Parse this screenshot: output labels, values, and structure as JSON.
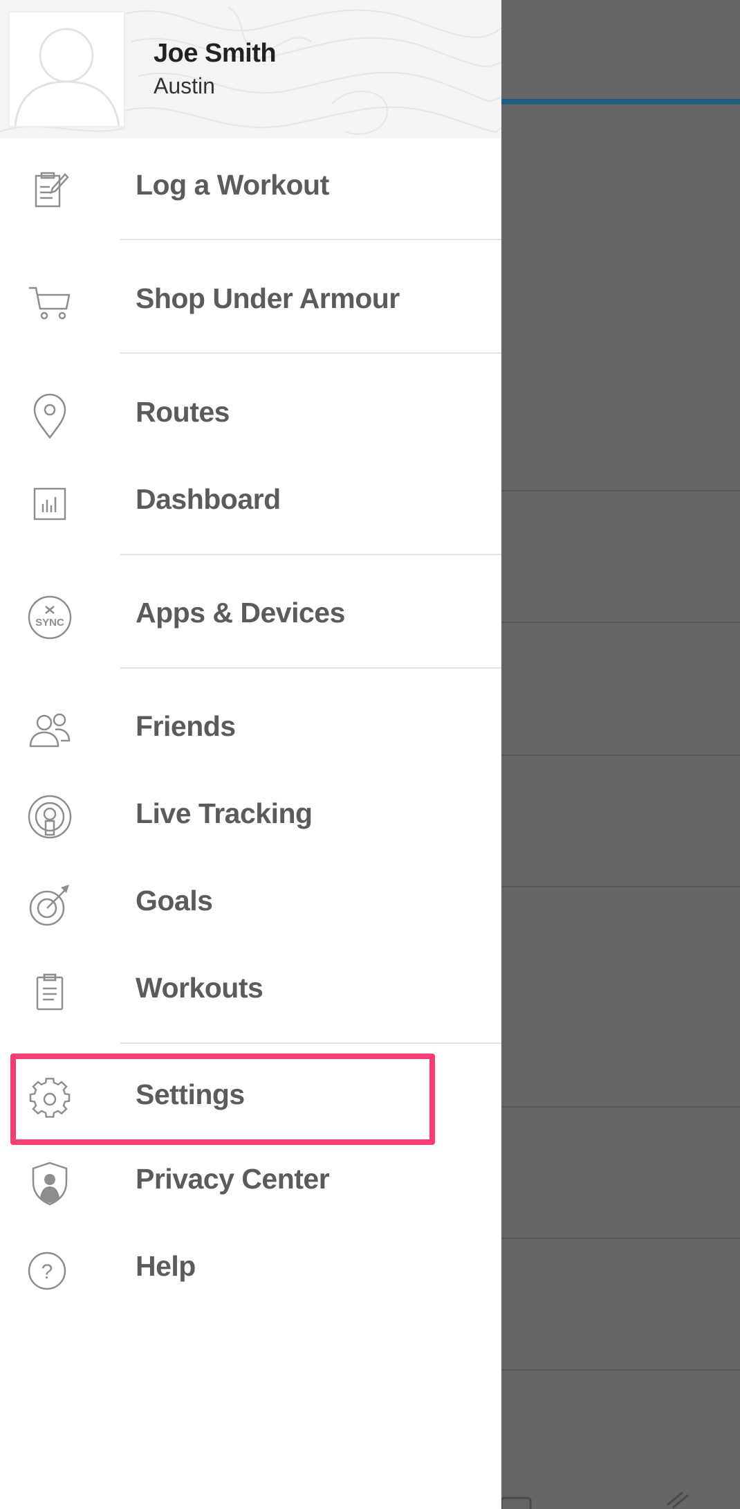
{
  "profile": {
    "name": "Joe Smith",
    "location": "Austin"
  },
  "menu": {
    "items": [
      {
        "label": "Log a Workout",
        "icon": "log-workout-icon"
      },
      {
        "label": "Shop Under Armour",
        "icon": "shopping-cart-icon"
      },
      {
        "label": "Routes",
        "icon": "location-pin-icon"
      },
      {
        "label": "Dashboard",
        "icon": "bar-chart-icon"
      },
      {
        "label": "Apps & Devices",
        "icon": "sync-icon",
        "icon_text": "SYNC"
      },
      {
        "label": "Friends",
        "icon": "friends-icon"
      },
      {
        "label": "Live Tracking",
        "icon": "live-tracking-icon"
      },
      {
        "label": "Goals",
        "icon": "target-icon"
      },
      {
        "label": "Workouts",
        "icon": "clipboard-icon"
      },
      {
        "label": "Settings",
        "icon": "gear-icon",
        "highlighted": true
      },
      {
        "label": "Privacy Center",
        "icon": "shield-user-icon"
      },
      {
        "label": "Help",
        "icon": "help-icon",
        "icon_text": "?"
      }
    ]
  },
  "colors": {
    "highlight": "#f73c72",
    "accent": "#1b5e80",
    "label": "#5b5b5b",
    "icon": "#8d8d8d",
    "overlay": "#656565"
  }
}
